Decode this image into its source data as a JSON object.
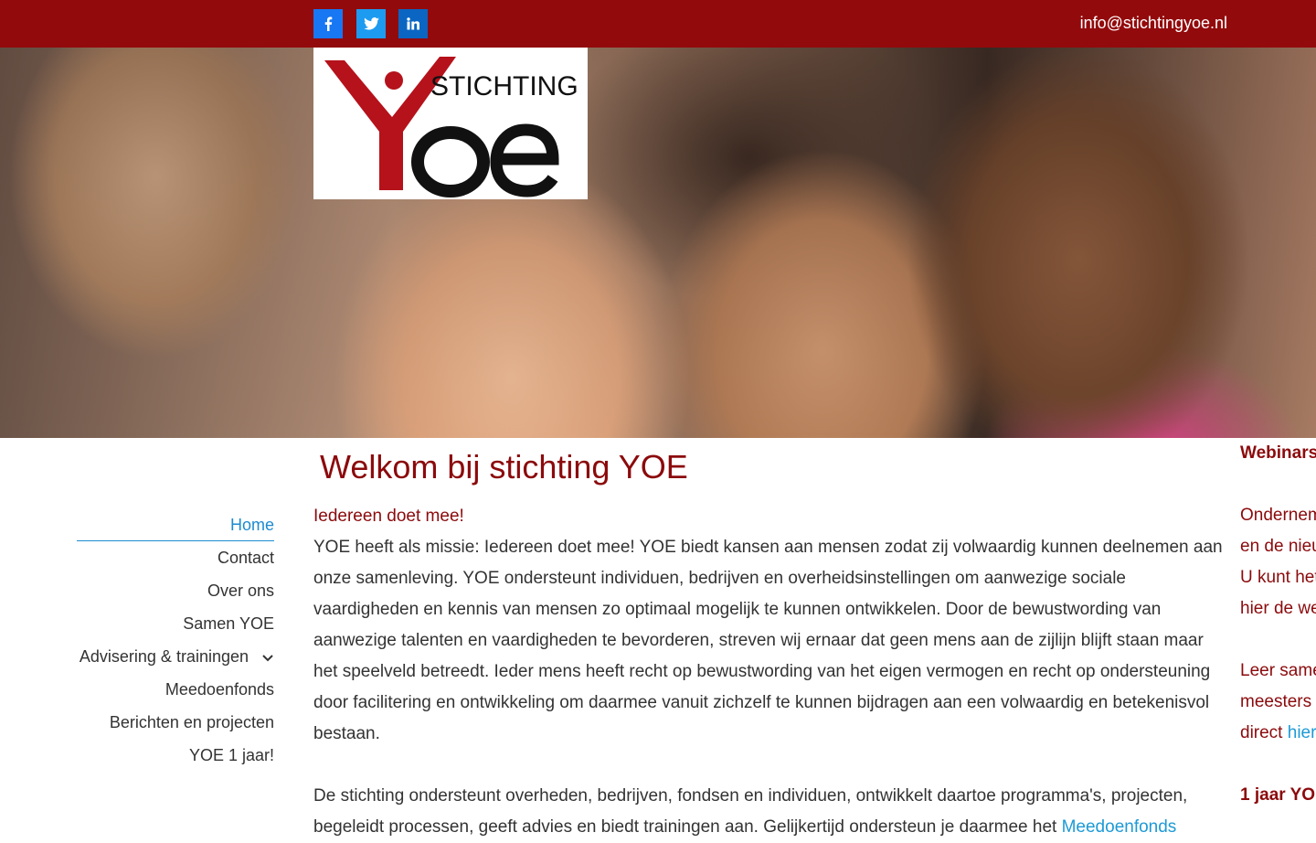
{
  "topbar": {
    "social": [
      {
        "name": "facebook",
        "icon": "facebook-icon"
      },
      {
        "name": "twitter",
        "icon": "twitter-icon"
      },
      {
        "name": "linkedin",
        "icon": "linkedin-icon"
      }
    ],
    "email": "info@stichtingyoe.nl",
    "bg_color": "#930a0c"
  },
  "logo": {
    "word": "STICHTING",
    "letters": "YOe"
  },
  "nav": {
    "items": [
      {
        "label": "Home"
      },
      {
        "label": "Contact"
      },
      {
        "label": "Over ons"
      },
      {
        "label": "Samen YOE"
      },
      {
        "label": "Advisering & trainingen"
      },
      {
        "label": "Meedoenfonds"
      },
      {
        "label": "Berichten en projecten"
      },
      {
        "label": "YOE 1 jaar!"
      }
    ],
    "active_color": "#1d8bd1"
  },
  "main": {
    "title": "Welkom bij stichting YOE",
    "subtitle": "Iedereen doet mee!",
    "paragraph1": "YOE heeft als missie: Iedereen doet mee! YOE biedt kansen aan mensen zodat zij volwaardig kunnen deelnemen aan onze samenleving. YOE ondersteunt individuen, bedrijven en overheidsinstellingen om aanwezige sociale vaardigheden en kennis van mensen zo optimaal mogelijk te kunnen ontwikkelen. Door de bewustwording van aanwezige talenten en vaardigheden te bevorderen, streven wij ernaar dat geen mens aan de zijlijn blijft staan maar het speelveld betreedt. Ieder mens heeft recht op bewustwording van het eigen vermogen en recht op ondersteuning door facilitering en ontwikkeling om daarmee vanuit zichzelf te kunnen bijdragen aan een volwaardig en betekenisvol bestaan.",
    "paragraph2_text": "De stichting ondersteunt overheden, bedrijven, fondsen en individuen, ontwikkelt daartoe programma's, projecten, begeleidt processen, geeft advies en biedt trainingen aan. Gelijkertijd ondersteun je daarmee het ",
    "paragraph2_link": "Meedoenfonds",
    "title_color": "#8b0a0c"
  },
  "right": {
    "heading": "Webinars",
    "line1": "Ondernem",
    "line2": "en de nieu",
    "line3": "U kunt het",
    "line4": "hier de we",
    "line5": "Leer same",
    "line6": "meesters",
    "line7_text": "direct ",
    "line7_link": "hier",
    "heading2": "1 jaar YO"
  }
}
